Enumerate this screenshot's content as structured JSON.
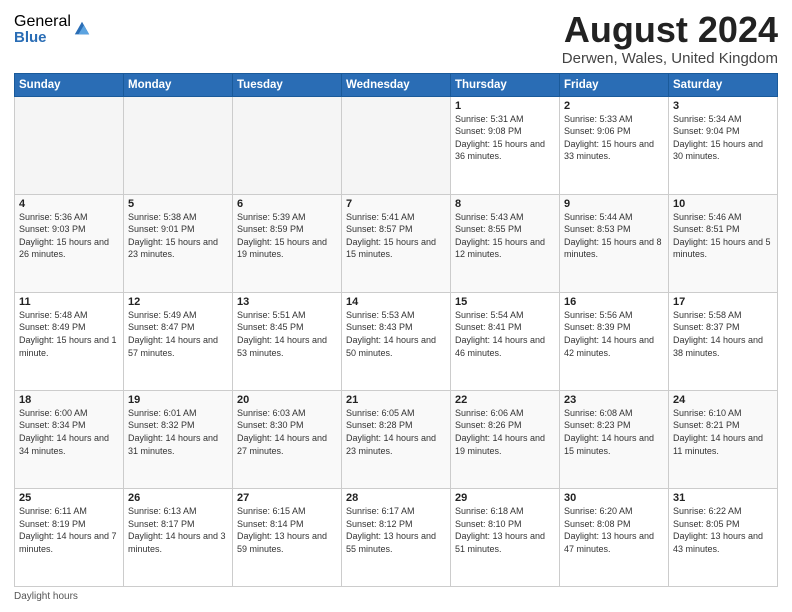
{
  "logo": {
    "general": "General",
    "blue": "Blue"
  },
  "title": "August 2024",
  "subtitle": "Derwen, Wales, United Kingdom",
  "days_header": [
    "Sunday",
    "Monday",
    "Tuesday",
    "Wednesday",
    "Thursday",
    "Friday",
    "Saturday"
  ],
  "weeks": [
    [
      {
        "num": "",
        "info": ""
      },
      {
        "num": "",
        "info": ""
      },
      {
        "num": "",
        "info": ""
      },
      {
        "num": "",
        "info": ""
      },
      {
        "num": "1",
        "info": "Sunrise: 5:31 AM\nSunset: 9:08 PM\nDaylight: 15 hours and 36 minutes."
      },
      {
        "num": "2",
        "info": "Sunrise: 5:33 AM\nSunset: 9:06 PM\nDaylight: 15 hours and 33 minutes."
      },
      {
        "num": "3",
        "info": "Sunrise: 5:34 AM\nSunset: 9:04 PM\nDaylight: 15 hours and 30 minutes."
      }
    ],
    [
      {
        "num": "4",
        "info": "Sunrise: 5:36 AM\nSunset: 9:03 PM\nDaylight: 15 hours and 26 minutes."
      },
      {
        "num": "5",
        "info": "Sunrise: 5:38 AM\nSunset: 9:01 PM\nDaylight: 15 hours and 23 minutes."
      },
      {
        "num": "6",
        "info": "Sunrise: 5:39 AM\nSunset: 8:59 PM\nDaylight: 15 hours and 19 minutes."
      },
      {
        "num": "7",
        "info": "Sunrise: 5:41 AM\nSunset: 8:57 PM\nDaylight: 15 hours and 15 minutes."
      },
      {
        "num": "8",
        "info": "Sunrise: 5:43 AM\nSunset: 8:55 PM\nDaylight: 15 hours and 12 minutes."
      },
      {
        "num": "9",
        "info": "Sunrise: 5:44 AM\nSunset: 8:53 PM\nDaylight: 15 hours and 8 minutes."
      },
      {
        "num": "10",
        "info": "Sunrise: 5:46 AM\nSunset: 8:51 PM\nDaylight: 15 hours and 5 minutes."
      }
    ],
    [
      {
        "num": "11",
        "info": "Sunrise: 5:48 AM\nSunset: 8:49 PM\nDaylight: 15 hours and 1 minute."
      },
      {
        "num": "12",
        "info": "Sunrise: 5:49 AM\nSunset: 8:47 PM\nDaylight: 14 hours and 57 minutes."
      },
      {
        "num": "13",
        "info": "Sunrise: 5:51 AM\nSunset: 8:45 PM\nDaylight: 14 hours and 53 minutes."
      },
      {
        "num": "14",
        "info": "Sunrise: 5:53 AM\nSunset: 8:43 PM\nDaylight: 14 hours and 50 minutes."
      },
      {
        "num": "15",
        "info": "Sunrise: 5:54 AM\nSunset: 8:41 PM\nDaylight: 14 hours and 46 minutes."
      },
      {
        "num": "16",
        "info": "Sunrise: 5:56 AM\nSunset: 8:39 PM\nDaylight: 14 hours and 42 minutes."
      },
      {
        "num": "17",
        "info": "Sunrise: 5:58 AM\nSunset: 8:37 PM\nDaylight: 14 hours and 38 minutes."
      }
    ],
    [
      {
        "num": "18",
        "info": "Sunrise: 6:00 AM\nSunset: 8:34 PM\nDaylight: 14 hours and 34 minutes."
      },
      {
        "num": "19",
        "info": "Sunrise: 6:01 AM\nSunset: 8:32 PM\nDaylight: 14 hours and 31 minutes."
      },
      {
        "num": "20",
        "info": "Sunrise: 6:03 AM\nSunset: 8:30 PM\nDaylight: 14 hours and 27 minutes."
      },
      {
        "num": "21",
        "info": "Sunrise: 6:05 AM\nSunset: 8:28 PM\nDaylight: 14 hours and 23 minutes."
      },
      {
        "num": "22",
        "info": "Sunrise: 6:06 AM\nSunset: 8:26 PM\nDaylight: 14 hours and 19 minutes."
      },
      {
        "num": "23",
        "info": "Sunrise: 6:08 AM\nSunset: 8:23 PM\nDaylight: 14 hours and 15 minutes."
      },
      {
        "num": "24",
        "info": "Sunrise: 6:10 AM\nSunset: 8:21 PM\nDaylight: 14 hours and 11 minutes."
      }
    ],
    [
      {
        "num": "25",
        "info": "Sunrise: 6:11 AM\nSunset: 8:19 PM\nDaylight: 14 hours and 7 minutes."
      },
      {
        "num": "26",
        "info": "Sunrise: 6:13 AM\nSunset: 8:17 PM\nDaylight: 14 hours and 3 minutes."
      },
      {
        "num": "27",
        "info": "Sunrise: 6:15 AM\nSunset: 8:14 PM\nDaylight: 13 hours and 59 minutes."
      },
      {
        "num": "28",
        "info": "Sunrise: 6:17 AM\nSunset: 8:12 PM\nDaylight: 13 hours and 55 minutes."
      },
      {
        "num": "29",
        "info": "Sunrise: 6:18 AM\nSunset: 8:10 PM\nDaylight: 13 hours and 51 minutes."
      },
      {
        "num": "30",
        "info": "Sunrise: 6:20 AM\nSunset: 8:08 PM\nDaylight: 13 hours and 47 minutes."
      },
      {
        "num": "31",
        "info": "Sunrise: 6:22 AM\nSunset: 8:05 PM\nDaylight: 13 hours and 43 minutes."
      }
    ]
  ],
  "footer": "Daylight hours"
}
